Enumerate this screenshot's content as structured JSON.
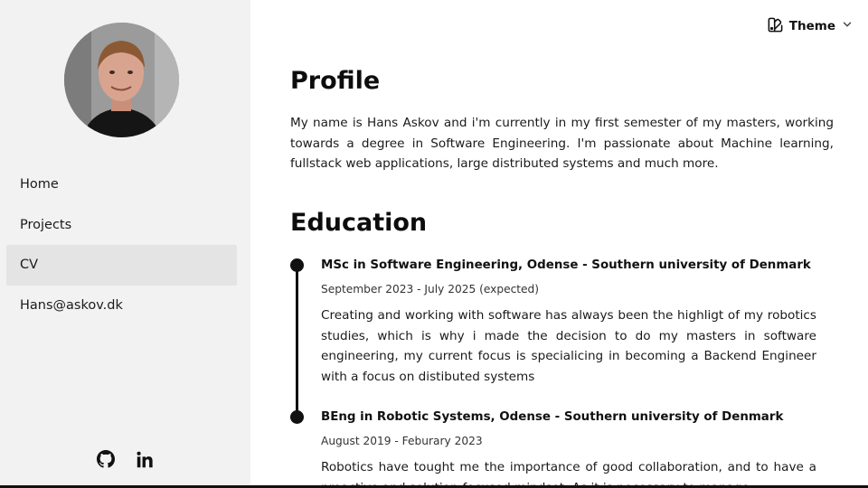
{
  "sidebar": {
    "avatar_icon": "profile-photo",
    "nav": [
      {
        "label": "Home",
        "active": false
      },
      {
        "label": "Projects",
        "active": false
      },
      {
        "label": "CV",
        "active": true
      },
      {
        "label": "Hans@askov.dk",
        "active": false
      }
    ],
    "social": [
      {
        "icon": "github-icon"
      },
      {
        "icon": "linkedin-icon"
      }
    ]
  },
  "header": {
    "theme_label": "Theme",
    "theme_icon": "palette-icon",
    "chevron_icon": "chevron-down-icon"
  },
  "profile": {
    "title": "Profile",
    "text": "My name is Hans Askov and i'm currently in my first semester of my masters, working towards a degree in Software Engineering. I'm passionate about Machine learning, fullstack web applications, large distributed systems and much more."
  },
  "education": {
    "title": "Education",
    "entries": [
      {
        "title": "MSc in Software Engineering, Odense - Southern university of Denmark",
        "date": "September 2023 - July 2025 (expected)",
        "desc": "Creating and working with software has always been the highligt of my robotics studies, which is why i made the decision to do my masters in software engineering, my current focus is specialicing in becoming a Backend Engineer with a focus on distibuted systems"
      },
      {
        "title": "BEng in Robotic Systems, Odense - Southern university of Denmark",
        "date": "August 2019 - Feburary 2023",
        "desc": "Robotics have tought me the importance of good collaboration, and to have a proactive and solution-focused mindset. As it is necessary to manage"
      }
    ]
  },
  "colors": {
    "sidebar_bg": "#f2f2f2",
    "active_nav_bg": "#e4e4e4",
    "text": "#111111"
  }
}
